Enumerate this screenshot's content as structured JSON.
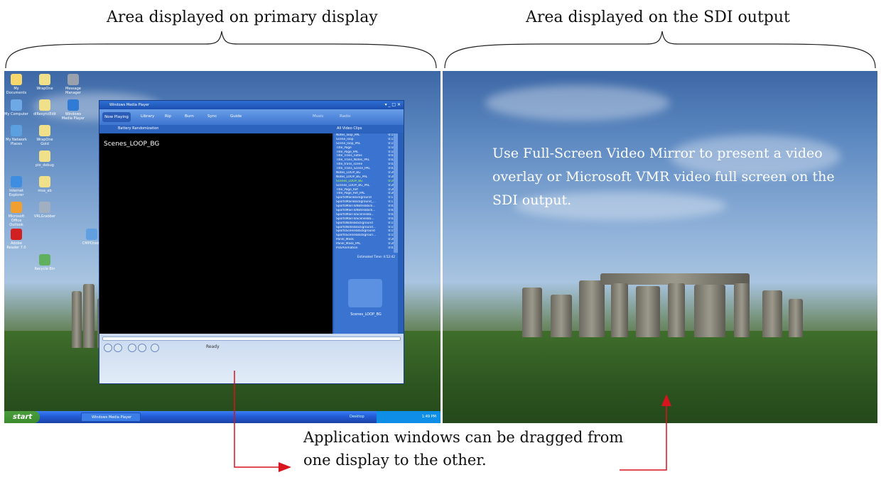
{
  "captions": {
    "primary": "Area displayed on primary display",
    "sdi": "Area displayed on the SDI output",
    "drag": "Application windows can be dragged from one display to the other."
  },
  "overlay_text": "Use Full-Screen Video Mirror to present a video overlay or Microsoft VMR video full screen on the SDI output.",
  "desktop_icons": [
    {
      "label": "My Documents",
      "color": "#f5d76e"
    },
    {
      "label": "WrapOne",
      "color": "#f0e08a"
    },
    {
      "label": "Message Manager",
      "color": "#9aa0ac"
    },
    {
      "label": "My Computer",
      "color": "#6ea9e6"
    },
    {
      "label": "dlResyncEdit",
      "color": "#f0e08a"
    },
    {
      "label": "Windows Media Player",
      "color": "#2f7bd6"
    },
    {
      "label": "My Network Places",
      "color": "#5ca0e0"
    },
    {
      "label": "WrapOne Gold",
      "color": "#f0e08a"
    },
    {
      "label": "pio_debug",
      "color": "#f0e08a"
    },
    {
      "label": "Internet Explorer",
      "color": "#3d8de0"
    },
    {
      "label": "msa_ab",
      "color": "#f0e08a"
    },
    {
      "label": "Microsoft Office Outlook",
      "color": "#f0a030"
    },
    {
      "label": "VRLGrabber",
      "color": "#a0b0c0"
    },
    {
      "label": "Adobe Reader 7.0",
      "color": "#d02020"
    },
    {
      "label": "Recycle Bin",
      "color": "#60b060"
    },
    {
      "label": "CMPCtools",
      "color": "#60a0e0"
    }
  ],
  "taskbar": {
    "start": "start",
    "task": "Windows Media Player",
    "tray_desktop": "Desktop",
    "clock": "1:49 PM"
  },
  "wmp": {
    "title": "Windows Media Player",
    "tabs": [
      "Now Playing",
      "Library",
      "Rip",
      "Burn",
      "Sync",
      "Guide"
    ],
    "tabs_right": [
      "Music",
      "Radio"
    ],
    "sub_left": "Battery   Randomization",
    "sub_right": "All Video Clips",
    "video_title": "Scenes_LOOP_BG",
    "status": "Ready",
    "est_time": "Estimated Time: 4:52:42",
    "art_label": "Scenes_LOOP_BG",
    "playlist": [
      {
        "name": "Notes_loop_PAL",
        "time": "0:15"
      },
      {
        "name": "Scene_loop",
        "time": "0:15"
      },
      {
        "name": "Scene_loop_PAL",
        "time": "0:15"
      },
      {
        "name": "Title_Page",
        "time": "0:18"
      },
      {
        "name": "Title_Page_PAL",
        "time": "0:18"
      },
      {
        "name": "Title_Trans_notes",
        "time": "0:02"
      },
      {
        "name": "Title_Trans_Notes_PAL",
        "time": "0:02"
      },
      {
        "name": "Title_trans_scene",
        "time": "0:02"
      },
      {
        "name": "Title_Trans_Scene_PAL",
        "time": "0:02"
      },
      {
        "name": "Notes_LOOP_BG",
        "time": "0:20"
      },
      {
        "name": "Notes_LOOP_BG_PAL",
        "time": "0:20"
      },
      {
        "name": "Scenes_LOOP_BG",
        "time": "0:20"
      },
      {
        "name": "Scenes_LOOP_BG_PAL",
        "time": "0:20"
      },
      {
        "name": "Title_Page_Ref",
        "time": "0:20"
      },
      {
        "name": "Title_Page_Ref_PAL",
        "time": "0:20"
      },
      {
        "name": "SportsMainBackground",
        "time": "0:17"
      },
      {
        "name": "SportsMainBackground_...",
        "time": "0:17"
      },
      {
        "name": "SportsMainToNotesBack...",
        "time": "0:02"
      },
      {
        "name": "SportsMainToNotesBack...",
        "time": "0:02"
      },
      {
        "name": "SportsMainToScenesBa...",
        "time": "0:02"
      },
      {
        "name": "SportsMainToScenesBa...",
        "time": "0:02"
      },
      {
        "name": "SportsNotesBackground",
        "time": "0:15"
      },
      {
        "name": "SportsNotesBackground...",
        "time": "0:15"
      },
      {
        "name": "SportsScenesBackground",
        "time": "0:15"
      },
      {
        "name": "SportsScenesBackgroun...",
        "time": "0:15"
      },
      {
        "name": "Panel_Mask",
        "time": "0:20"
      },
      {
        "name": "Panel_Mask_PAL",
        "time": "0:20"
      },
      {
        "name": "PickAnimation",
        "time": "0:03"
      }
    ],
    "active_index": 11
  }
}
